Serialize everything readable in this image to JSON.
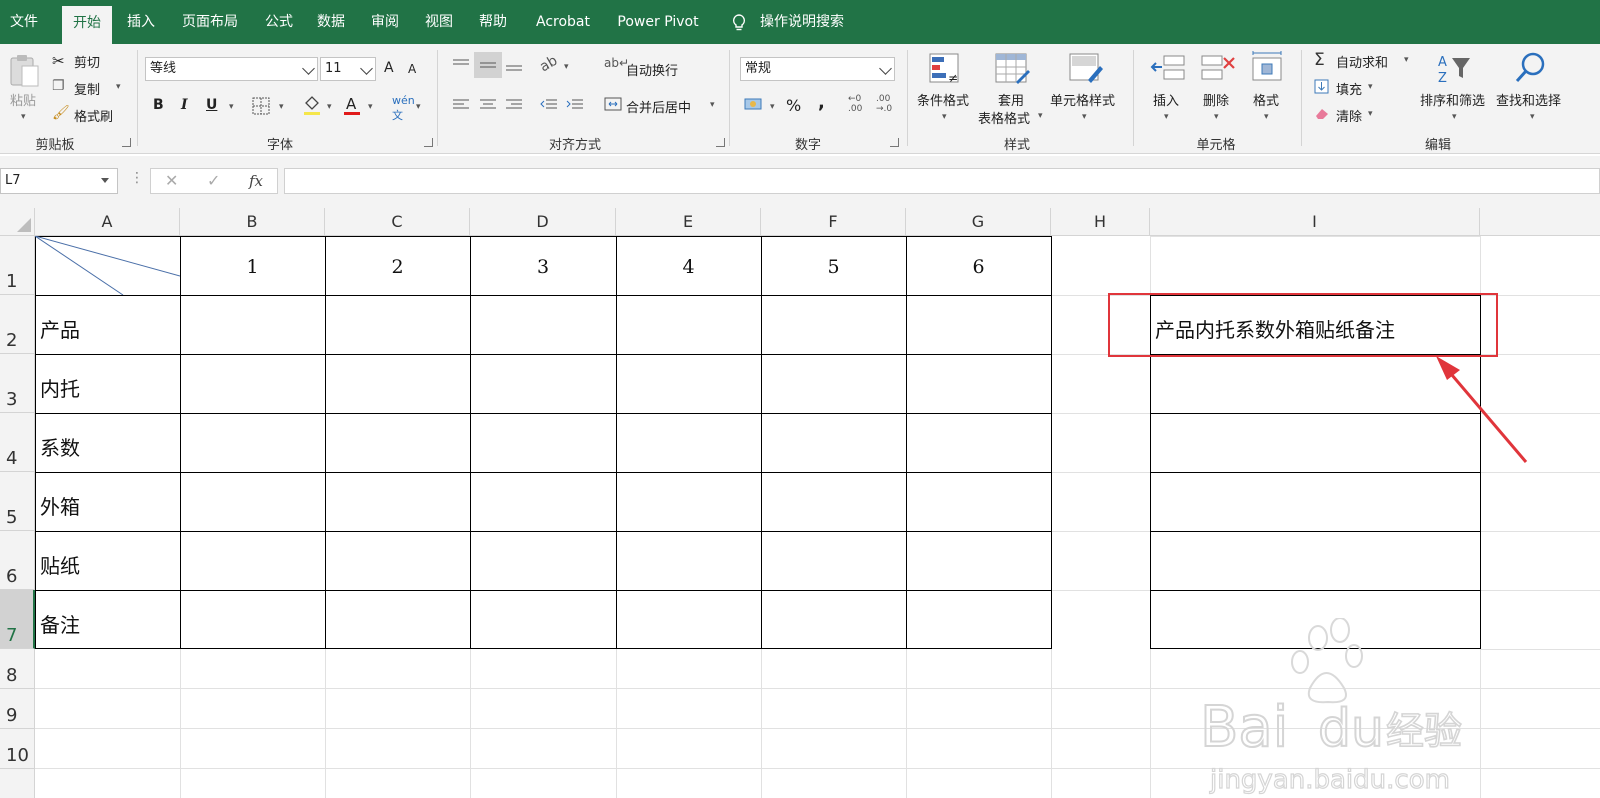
{
  "menu": {
    "items": [
      "文件",
      "开始",
      "插入",
      "页面布局",
      "公式",
      "数据",
      "审阅",
      "视图",
      "帮助",
      "Acrobat",
      "Power Pivot"
    ],
    "active_index": 1,
    "search_label": "操作说明搜索"
  },
  "ribbon": {
    "clipboard": {
      "label": "剪贴板",
      "paste": "粘贴",
      "cut": "剪切",
      "copy": "复制",
      "format_painter": "格式刷"
    },
    "font": {
      "label": "字体",
      "font_name": "等线",
      "font_size": "11",
      "bold": "B",
      "italic": "I",
      "underline": "U",
      "grow": "A",
      "shrink": "A"
    },
    "alignment": {
      "label": "对齐方式",
      "wrap_text": "自动换行",
      "merge_center": "合并后居中"
    },
    "number": {
      "label": "数字",
      "format": "常规",
      "percent": "%",
      "comma": ","
    },
    "styles": {
      "label": "样式",
      "conditional": "条件格式",
      "table_format_1": "套用",
      "table_format_2": "表格格式",
      "cell_styles": "单元格样式"
    },
    "cells": {
      "label": "单元格",
      "insert": "插入",
      "delete": "删除",
      "format": "格式"
    },
    "editing": {
      "label": "编辑",
      "autosum": "自动求和",
      "fill": "填充",
      "clear": "清除",
      "sort_filter": "排序和筛选",
      "find_select": "查找和选择"
    }
  },
  "formula_bar": {
    "name_box": "L7",
    "fx": "fx",
    "value": ""
  },
  "sheet": {
    "columns": [
      "A",
      "B",
      "C",
      "D",
      "E",
      "F",
      "G",
      "H",
      "I"
    ],
    "rows": [
      "1",
      "2",
      "3",
      "4",
      "5",
      "6",
      "7",
      "8",
      "9",
      "10"
    ],
    "selected_row": "7",
    "header_numbers": [
      "1",
      "2",
      "3",
      "4",
      "5",
      "6"
    ],
    "row_labels": [
      "产品",
      "内托",
      "系数",
      "外箱",
      "贴纸",
      "备注"
    ],
    "i2_text": "产品内托系数外箱贴纸备注"
  },
  "colors": {
    "excel_green": "#217346",
    "highlight_red": "#e0353b"
  },
  "watermark": {
    "brand": "Bai",
    "brand2": "du",
    "cn": "经验",
    "url": "jingyan.baidu.com"
  }
}
